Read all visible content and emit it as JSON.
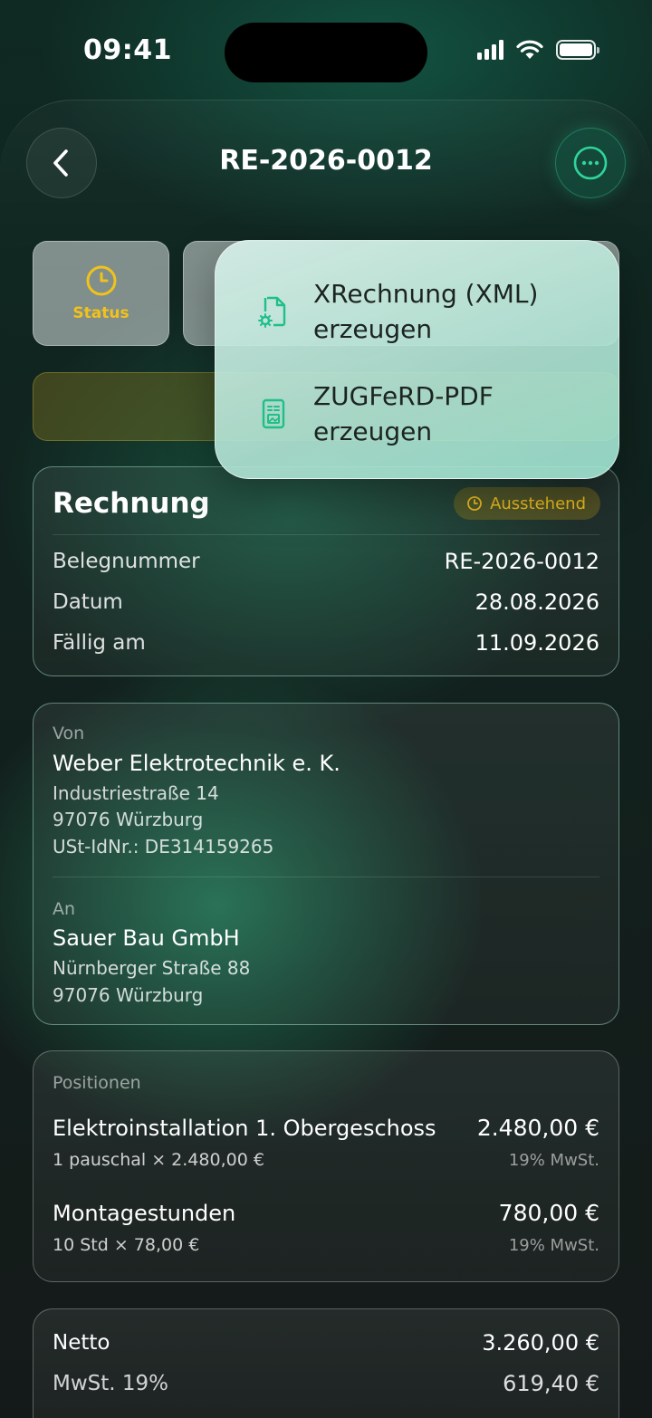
{
  "status_bar": {
    "time": "09:41"
  },
  "nav": {
    "title": "RE-2026-0012"
  },
  "actions": {
    "status_label": "Status"
  },
  "menu": {
    "items": [
      {
        "label": "XRechnung (XML) erzeugen",
        "icon": "file-gear-icon"
      },
      {
        "label": "ZUGFeRD-PDF erzeugen",
        "icon": "document-image-icon"
      }
    ]
  },
  "invoice": {
    "title": "Rechnung",
    "status": "Ausstehend",
    "rows": [
      {
        "label": "Belegnummer",
        "value": "RE-2026-0012"
      },
      {
        "label": "Datum",
        "value": "28.08.2026"
      },
      {
        "label": "Fällig am",
        "value": "11.09.2026"
      }
    ]
  },
  "parties": {
    "from": {
      "caption": "Von",
      "name": "Weber Elektrotechnik e. K.",
      "lines": [
        "Industriestraße 14",
        "97076 Würzburg",
        "USt-IdNr.: DE314159265"
      ]
    },
    "to": {
      "caption": "An",
      "name": "Sauer Bau GmbH",
      "lines": [
        "Nürnberger Straße 88",
        "97076 Würzburg"
      ]
    }
  },
  "items": {
    "caption": "Positionen",
    "list": [
      {
        "name": "Elektroinstallation 1. Obergeschoss",
        "detail": "1 pauschal × 2.480,00 €",
        "price": "2.480,00 €",
        "tax": "19% MwSt."
      },
      {
        "name": "Montagestunden",
        "detail": "10 Std × 78,00 €",
        "price": "780,00 €",
        "tax": "19% MwSt."
      }
    ]
  },
  "totals": {
    "rows": [
      {
        "label": "Netto",
        "value": "3.260,00 €"
      },
      {
        "label": "MwSt. 19%",
        "value": "619,40 €"
      }
    ]
  },
  "colors": {
    "accent": "#2fd59a",
    "warning": "#f2c21b"
  }
}
